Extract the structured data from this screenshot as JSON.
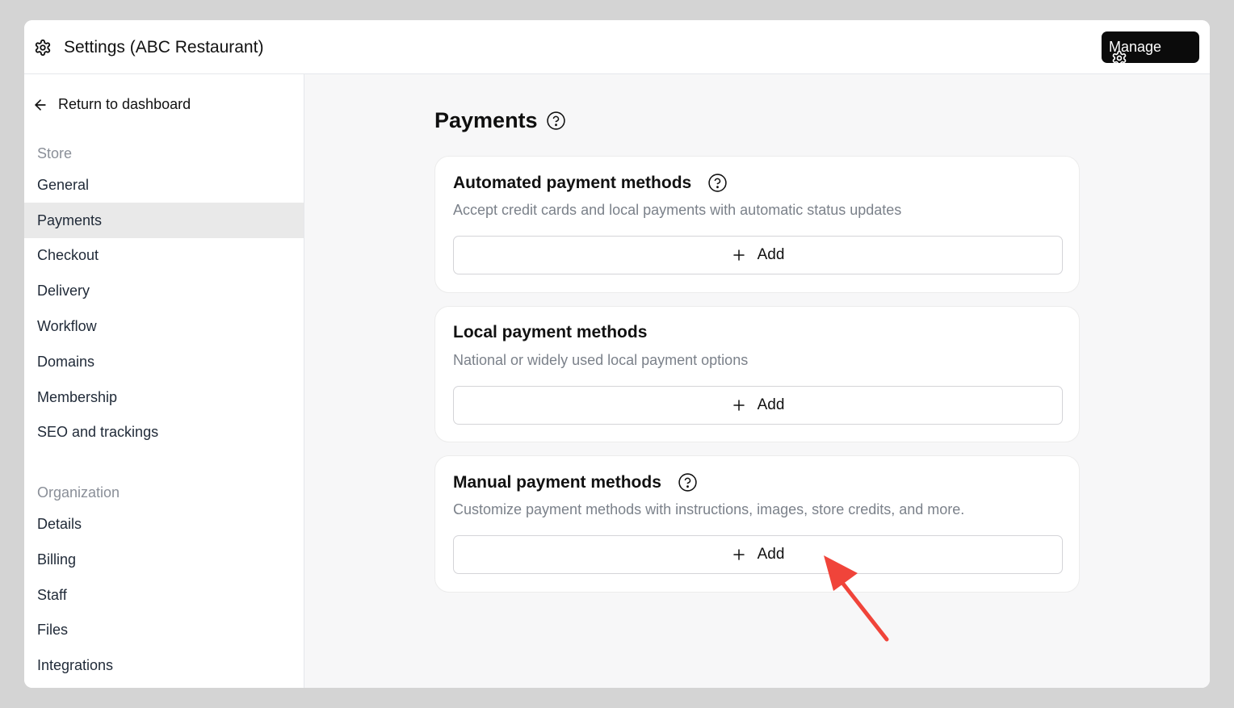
{
  "header": {
    "title": "Settings (ABC Restaurant)",
    "manage_label": "Manage"
  },
  "sidebar": {
    "back_label": "Return to dashboard",
    "store_heading": "Store",
    "store_items": [
      {
        "label": "General"
      },
      {
        "label": "Payments",
        "active": true
      },
      {
        "label": "Checkout"
      },
      {
        "label": "Delivery"
      },
      {
        "label": "Workflow"
      },
      {
        "label": "Domains"
      },
      {
        "label": "Membership"
      },
      {
        "label": "SEO and trackings"
      }
    ],
    "org_heading": "Organization",
    "org_items": [
      {
        "label": "Details"
      },
      {
        "label": "Billing"
      },
      {
        "label": "Staff"
      },
      {
        "label": "Files"
      },
      {
        "label": "Integrations"
      }
    ]
  },
  "main": {
    "title": "Payments",
    "cards": [
      {
        "title": "Automated payment methods",
        "has_help": true,
        "description": "Accept credit cards and local payments with automatic status updates",
        "button_label": "Add"
      },
      {
        "title": "Local payment methods",
        "has_help": false,
        "description": "National or widely used local payment options",
        "button_label": "Add"
      },
      {
        "title": "Manual payment methods",
        "has_help": true,
        "description": "Customize payment methods with instructions, images, store credits, and more.",
        "button_label": "Add"
      }
    ]
  },
  "colors": {
    "accent_dark": "#0b0b0b",
    "annotation_arrow": "#f0443a",
    "active_nav_bg": "#e9e9e9"
  },
  "icons": [
    "gear-icon",
    "arrow-left-icon",
    "help-circle-icon",
    "plus-icon"
  ]
}
